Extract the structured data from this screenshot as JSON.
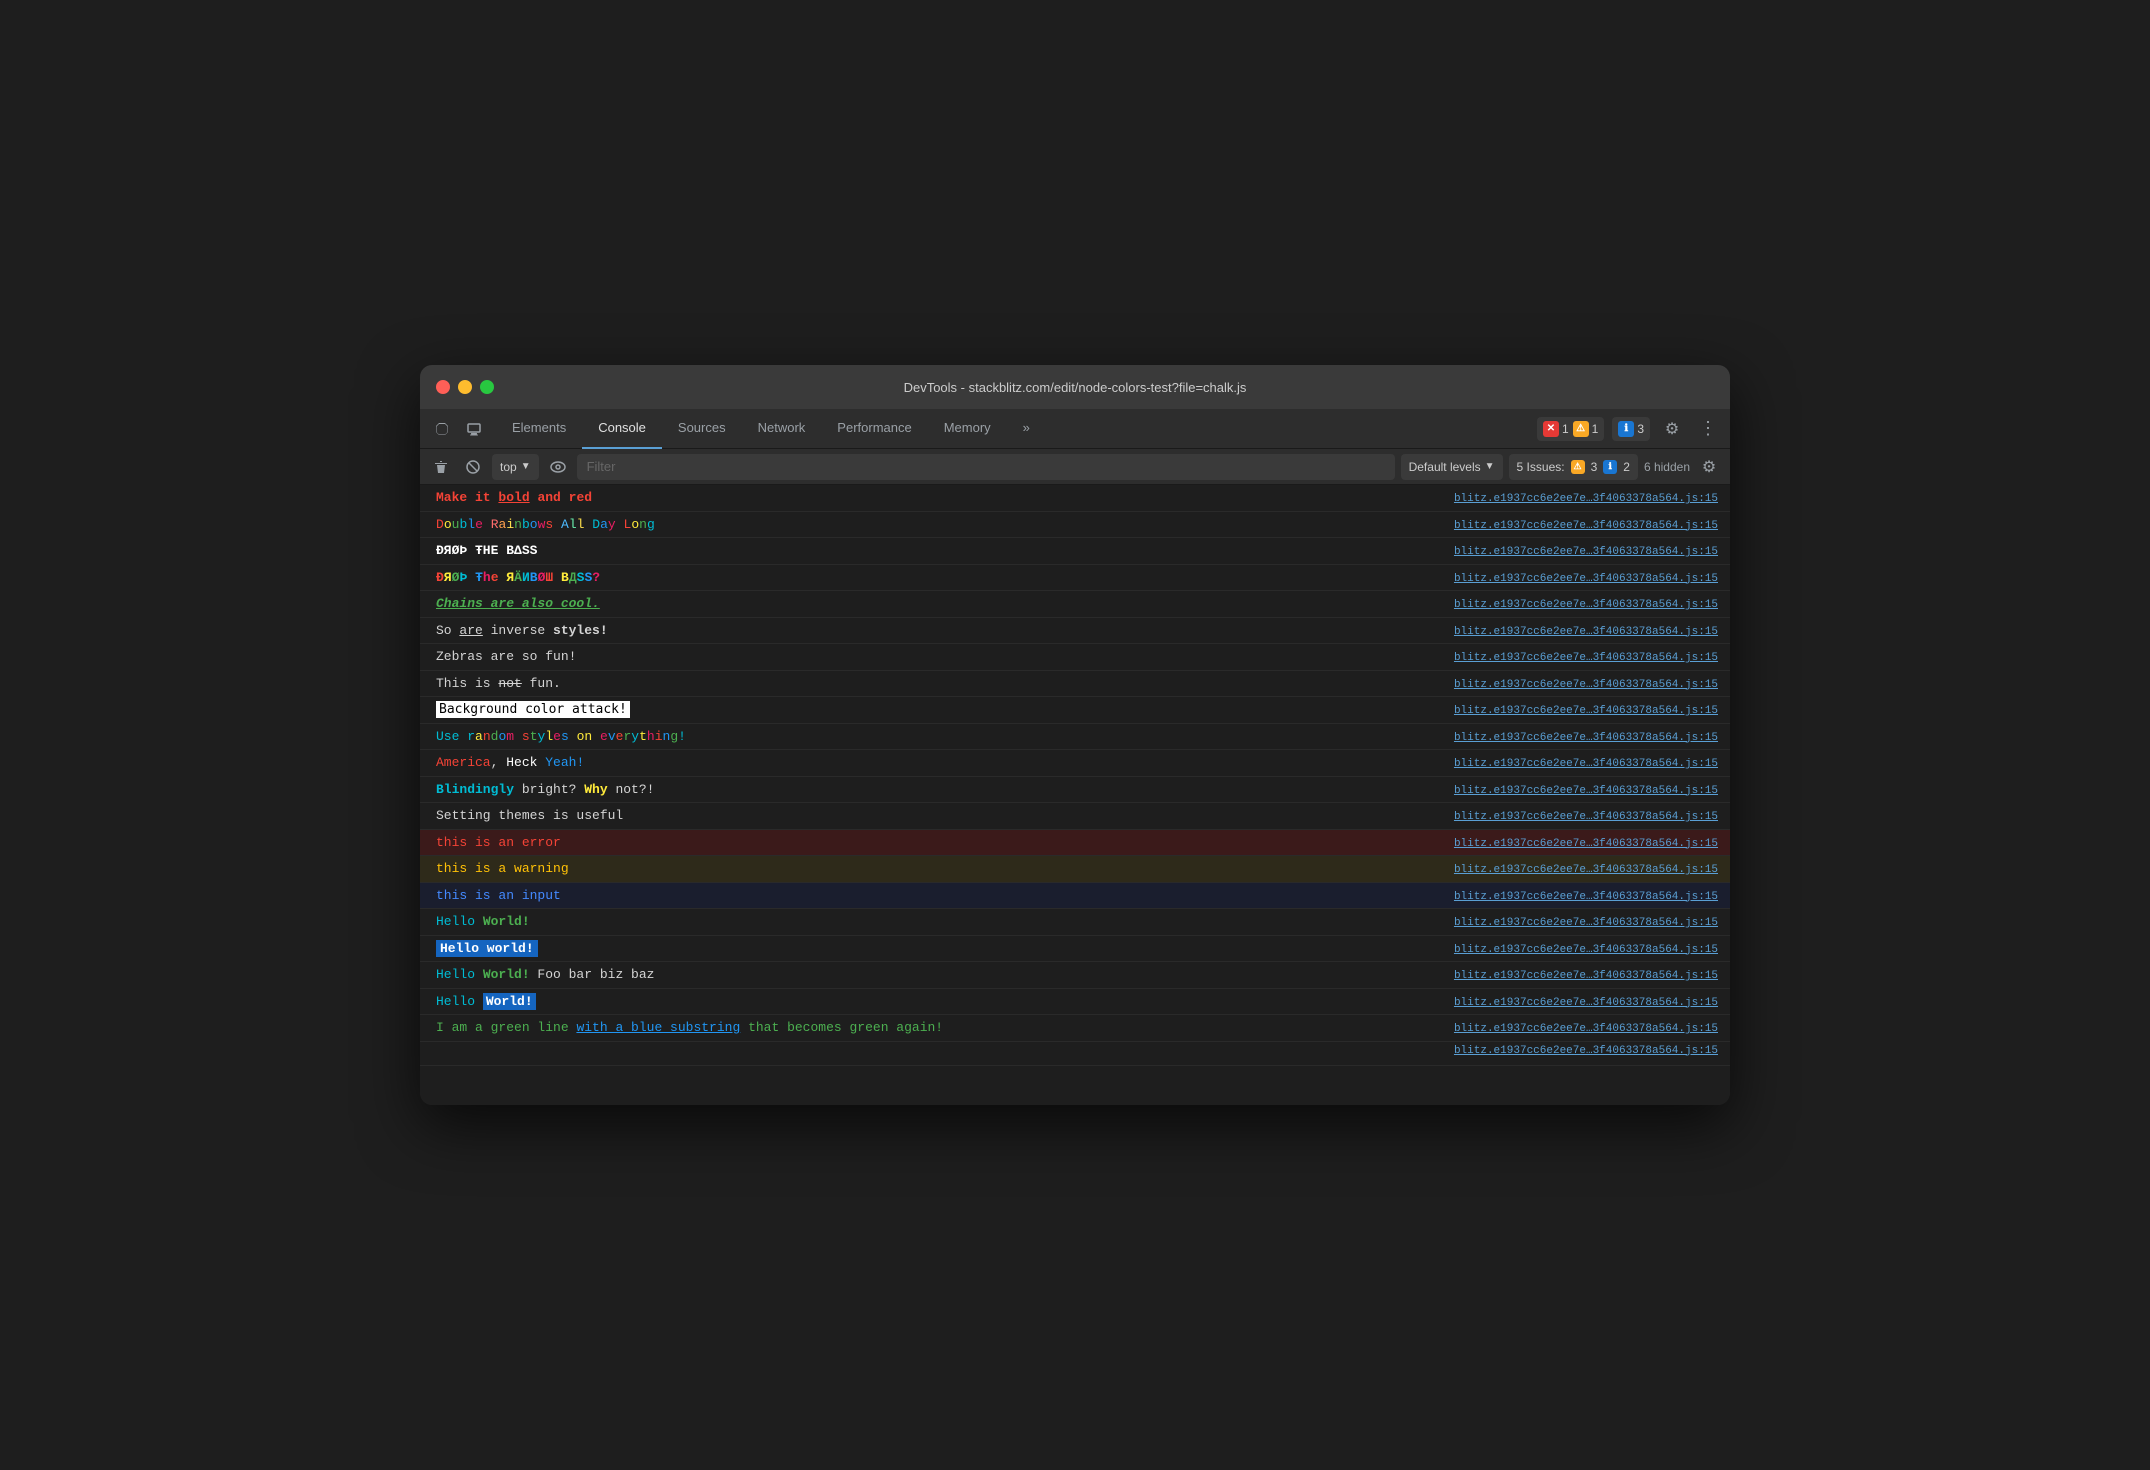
{
  "window": {
    "title": "DevTools - stackblitz.com/edit/node-colors-test?file=chalk.js"
  },
  "tabs": {
    "items": [
      {
        "label": "Elements",
        "active": false
      },
      {
        "label": "Console",
        "active": true
      },
      {
        "label": "Sources",
        "active": false
      },
      {
        "label": "Network",
        "active": false
      },
      {
        "label": "Performance",
        "active": false
      },
      {
        "label": "Memory",
        "active": false
      }
    ]
  },
  "toolbar": {
    "top_label": "top",
    "filter_placeholder": "Filter",
    "levels_label": "Default levels",
    "issues_label": "5 Issues:",
    "issues_warn_count": "3",
    "issues_info_count": "2",
    "hidden_label": "6 hidden"
  },
  "badges": {
    "error_count": "1",
    "warn_count": "1",
    "info_count": "3"
  },
  "source": "blitz.e1937cc6e2ee7e…3f4063378a564.js:15",
  "console_rows": [
    {
      "id": 1,
      "type": "normal"
    },
    {
      "id": 2,
      "type": "normal"
    },
    {
      "id": 3,
      "type": "normal"
    },
    {
      "id": 4,
      "type": "normal"
    },
    {
      "id": 5,
      "type": "normal"
    },
    {
      "id": 6,
      "type": "normal"
    },
    {
      "id": 7,
      "type": "normal"
    },
    {
      "id": 8,
      "type": "normal"
    },
    {
      "id": 9,
      "type": "normal"
    },
    {
      "id": 10,
      "type": "normal"
    },
    {
      "id": 11,
      "type": "normal"
    },
    {
      "id": 12,
      "type": "normal"
    },
    {
      "id": 13,
      "type": "error"
    },
    {
      "id": 14,
      "type": "warn"
    },
    {
      "id": 15,
      "type": "input"
    },
    {
      "id": 16,
      "type": "normal"
    },
    {
      "id": 17,
      "type": "normal"
    },
    {
      "id": 18,
      "type": "normal"
    },
    {
      "id": 19,
      "type": "normal"
    },
    {
      "id": 20,
      "type": "normal"
    }
  ]
}
